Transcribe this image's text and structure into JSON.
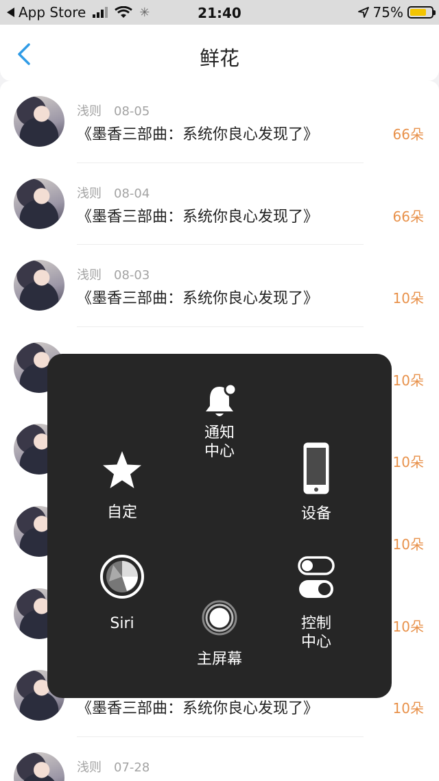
{
  "status_bar": {
    "back_app": "App Store",
    "time": "21:40",
    "battery_percent": "75%",
    "battery_level": 0.75,
    "icons": [
      "back-triangle-icon",
      "cellular-signal-icon",
      "wifi-icon",
      "activity-spinner-icon",
      "location-arrow-icon",
      "battery-icon"
    ]
  },
  "nav": {
    "title": "鲜花",
    "back_icon": "chevron-left-icon"
  },
  "list": [
    {
      "user": "浅则",
      "date": "08-05",
      "title": "《墨香三部曲：系统你良心发现了》",
      "amount": "66朵"
    },
    {
      "user": "浅则",
      "date": "08-04",
      "title": "《墨香三部曲：系统你良心发现了》",
      "amount": "66朵"
    },
    {
      "user": "浅则",
      "date": "08-03",
      "title": "《墨香三部曲：系统你良心发现了》",
      "amount": "10朵"
    },
    {
      "user": "",
      "date": "",
      "title": "",
      "amount": "10朵"
    },
    {
      "user": "",
      "date": "",
      "title": "",
      "amount": "10朵"
    },
    {
      "user": "",
      "date": "",
      "title": "",
      "amount": "10朵"
    },
    {
      "user": "",
      "date": "",
      "title": "",
      "amount": "10朵"
    },
    {
      "user": "",
      "date": "",
      "title": "《墨香三部曲：系统你良心发现了》",
      "amount": "10朵"
    },
    {
      "user": "浅则",
      "date": "07-28",
      "title": "",
      "amount": ""
    }
  ],
  "assistive_touch": {
    "notification_center": "通知\n中心",
    "custom": "自定",
    "device": "设备",
    "siri": "Siri",
    "control_center": "控制\n中心",
    "home": "主屏幕"
  },
  "colors": {
    "accent_orange": "#e8914a",
    "nav_back_blue": "#2f9be6",
    "panel_bg": "#262626",
    "battery_yellow": "#f3c400"
  }
}
